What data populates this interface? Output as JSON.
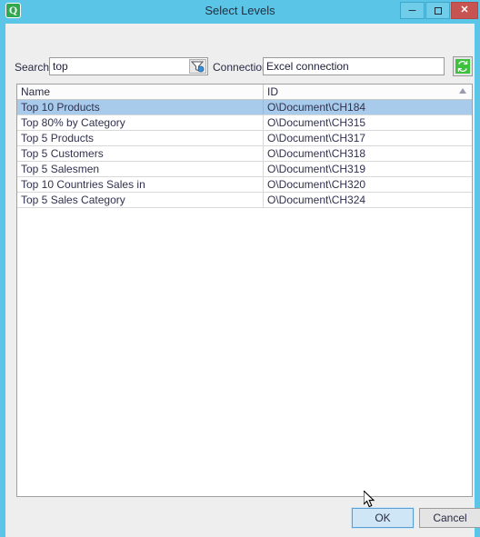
{
  "window": {
    "title": "Select Levels",
    "app_icon": "qlik-app-icon",
    "app_icon_glyph": "Q",
    "accent_color": "#5bc5e7",
    "controls": {
      "minimize_label": "–",
      "maximize_label": "□",
      "close_label": "✕"
    }
  },
  "toolbar": {
    "search_label": "Search",
    "search_value": "top",
    "search_placeholder": "",
    "filter_icon": "funnel-filter-icon",
    "connection_label": "Connection",
    "connection_value": "Excel connection",
    "connection_placeholder": "",
    "refresh_icon": "refresh-sync-icon",
    "refresh_color": "#3ec13e"
  },
  "list": {
    "columns": [
      {
        "key": "name",
        "label": "Name",
        "sorted": false
      },
      {
        "key": "id",
        "label": "ID",
        "sorted": true,
        "sort_direction": "ascending",
        "sort_glyph": "sort-ascending-triangle"
      }
    ],
    "selected_index": 0,
    "selection_color": "#a8cbec",
    "rows": [
      {
        "name": "Top 10 Products",
        "id": "O\\Document\\CH184"
      },
      {
        "name": "Top 80% by Category",
        "id": "O\\Document\\CH315"
      },
      {
        "name": "Top 5 Products",
        "id": "O\\Document\\CH317"
      },
      {
        "name": "Top 5 Customers",
        "id": "O\\Document\\CH318"
      },
      {
        "name": "Top 5 Salesmen",
        "id": "O\\Document\\CH319"
      },
      {
        "name": "Top 10 Countries Sales in",
        "id": "O\\Document\\CH320"
      },
      {
        "name": "Top 5 Sales Category",
        "id": "O\\Document\\CH324"
      }
    ]
  },
  "footer": {
    "ok_label": "OK",
    "cancel_label": "Cancel",
    "focused_button": "OK"
  },
  "cursor": {
    "icon": "arrow-pointer",
    "over": "ok-button"
  }
}
